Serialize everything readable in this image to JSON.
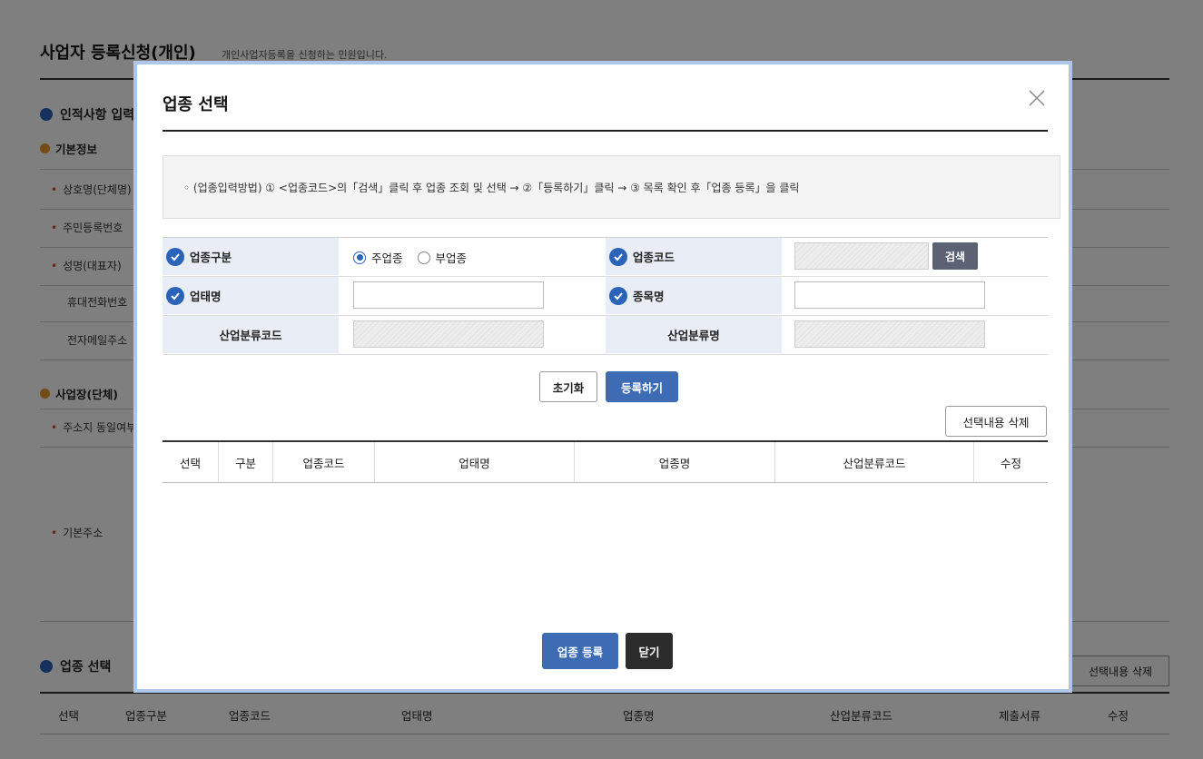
{
  "page": {
    "title": "사업자 등록신청(개인)",
    "description": "개인사업자등록을 신청하는 민원입니다.",
    "section_personal": "인적사항 입력",
    "sub_basic": "기본정보",
    "rows": [
      {
        "label": "상호명(단체명)",
        "required": true
      },
      {
        "label": "주민등록번호",
        "required": true
      },
      {
        "label": "성명(대표자)",
        "required": true
      },
      {
        "label": "휴대전화번호",
        "required": false
      },
      {
        "label": "전자메일주소",
        "required": false
      }
    ],
    "sub_workplace": "사업장(단체)",
    "row_addr_same": "주소지 동일여부",
    "row_base_addr": "기본주소",
    "section_biz": "업종 선택",
    "delete_label": "선택내용 삭제",
    "table_headers": [
      "선택",
      "업종구분",
      "업종코드",
      "업태명",
      "업종명",
      "산업분류코드",
      "제출서류",
      "수정"
    ]
  },
  "modal": {
    "title": "업종 선택",
    "close_label": "×",
    "guide": "◦ (업종입력방법) ① <업종코드>의「검색」클릭 후 업종 조회 및 선택 → ②「등록하기」클릭 → ③ 목록 확인 후「업종 등록」을 클릭",
    "form": {
      "biz_type_label": "업종구분",
      "radio_main": "주업종",
      "radio_sub": "부업종",
      "biz_code_label": "업종코드",
      "search_button": "검색",
      "business_name_label": "업태명",
      "item_name_label": "종목명",
      "industry_code_label": "산업분류코드",
      "industry_name_label": "산업분류명"
    },
    "reset_button": "초기화",
    "register_button": "등록하기",
    "delete_selected_button": "선택내용 삭제",
    "grid_headers": [
      "선택",
      "구분",
      "업종코드",
      "업태명",
      "업종명",
      "산업분류코드",
      "수정"
    ],
    "biz_register_button": "업종 등록",
    "close_button": "닫기"
  },
  "colors": {
    "accent": "#3e6cb4",
    "check": "#2a63b8",
    "dark_button": "#2c2c2c",
    "search_button": "#5a6274"
  }
}
